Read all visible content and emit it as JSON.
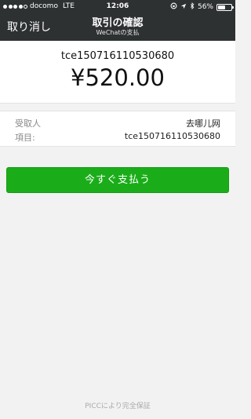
{
  "status_bar": {
    "carrier": "docomo",
    "network": "LTE",
    "time": "12:06",
    "battery_percent_text": "56%",
    "battery_level": 0.56,
    "signal_bars_filled": 4,
    "signal_bars_total": 5
  },
  "nav": {
    "back_label": "取り消し",
    "title": "取引の確認",
    "subtitle": "WeChatの支払"
  },
  "payment": {
    "order_id": "tce150716110530680",
    "amount": "¥520.00"
  },
  "details": {
    "payee_label": "受取人",
    "payee_value": "去哪儿网",
    "item_label": "項目:",
    "item_value": "tce150716110530680"
  },
  "actions": {
    "pay_label": "今すぐ支払う"
  },
  "footer": {
    "text": "PICCにより完全保証"
  },
  "colors": {
    "header_bg": "#2e3132",
    "primary_green": "#1aad19",
    "page_bg": "#f2f2f2"
  }
}
